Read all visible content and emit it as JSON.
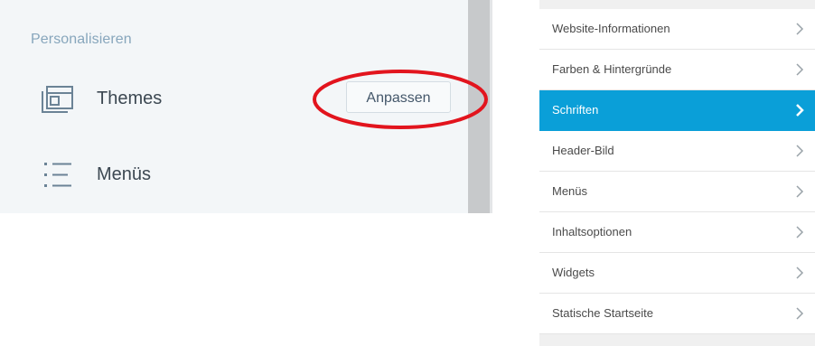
{
  "left_panel": {
    "section_title": "Personalisieren",
    "items": [
      {
        "label": "Themes",
        "icon": "themes-icon"
      },
      {
        "label": "Menüs",
        "icon": "menus-icon"
      }
    ],
    "customize_button": "Anpassen",
    "highlight_color": "#e2141d"
  },
  "right_panel": {
    "items": [
      {
        "label": "Website-Informationen",
        "active": false
      },
      {
        "label": "Farben & Hintergründe",
        "active": false
      },
      {
        "label": "Schriften",
        "active": true
      },
      {
        "label": "Header-Bild",
        "active": false
      },
      {
        "label": "Menüs",
        "active": false
      },
      {
        "label": "Inhaltsoptionen",
        "active": false
      },
      {
        "label": "Widgets",
        "active": false
      },
      {
        "label": "Statische Startseite",
        "active": false
      }
    ],
    "active_color": "#0a9fd8"
  }
}
